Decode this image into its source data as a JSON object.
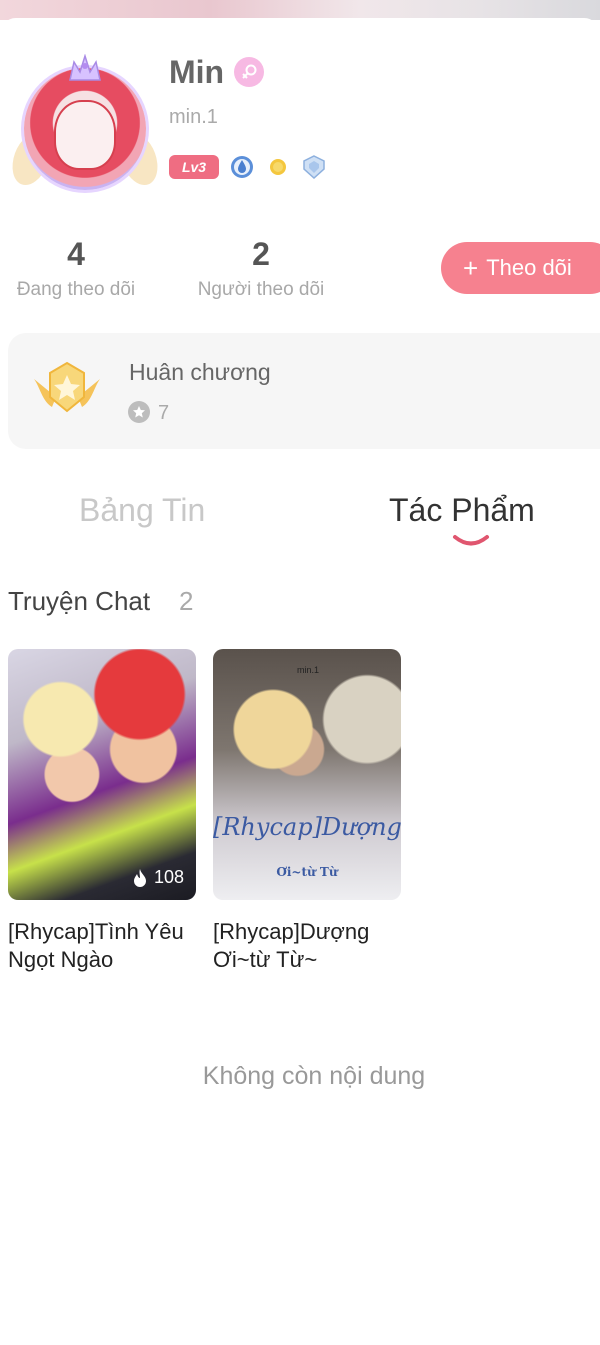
{
  "profile": {
    "name": "Min",
    "handle": "min.1",
    "level": "Lv3"
  },
  "stats": {
    "following_count": "4",
    "following_label": "Đang theo dõi",
    "followers_count": "2",
    "followers_label": "Người theo dõi"
  },
  "follow_button": {
    "plus": "+",
    "label": "Theo dõi"
  },
  "medals": {
    "title": "Huân chương",
    "count": "7"
  },
  "tabs": [
    {
      "label": "Bảng Tin",
      "active": false
    },
    {
      "label": "Tác Phẩm",
      "active": true
    }
  ],
  "section": {
    "title": "Truyện Chat",
    "count": "2"
  },
  "stories": [
    {
      "title": "[Rhycap]Tình Yêu Ngọt Ngào",
      "views": "108"
    },
    {
      "title": "[Rhycap]Dượng Ơi~từ Từ~",
      "cover_title": "[Rhycap]Dượng",
      "cover_subtitle": "Ơi~từ Từ",
      "cover_watermark": "min.1"
    }
  ],
  "end_message": "Không còn nội dung",
  "colors": {
    "accent": "#f6818f",
    "level_badge": "#ef6d82",
    "tab_indicator": "#e0566f"
  }
}
